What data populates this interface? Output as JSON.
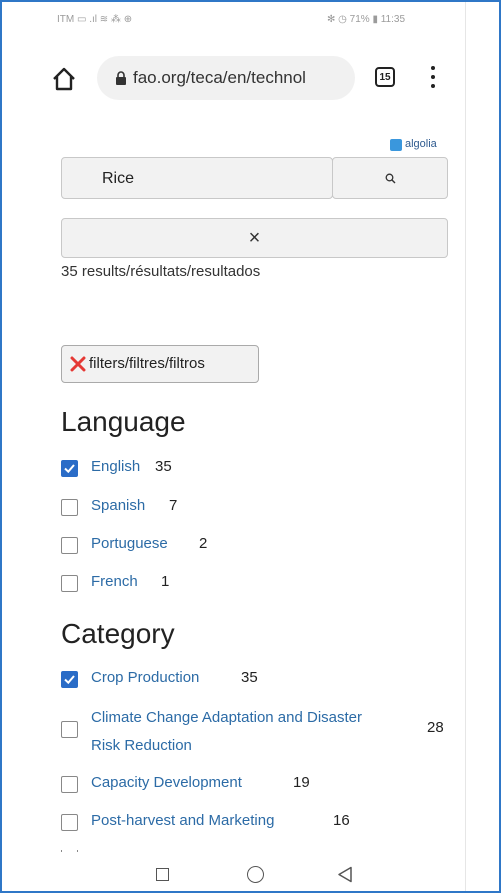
{
  "status_bar": {
    "left": "ITM ▭ .ıl ≋ ⁂ ⊕",
    "right": "✻ ◷ 71% ▮ 11:35"
  },
  "browser": {
    "url": "fao.org/teca/en/technol",
    "tab_count": "15"
  },
  "search": {
    "powered_by": "algolia",
    "query": "Rice",
    "clear_label": "×",
    "results_text": "35 results/résultats/resultados"
  },
  "filters_button": {
    "label": "filters/filtres/filtros"
  },
  "language": {
    "heading": "Language",
    "items": [
      {
        "label": "English",
        "count": "35",
        "checked": true
      },
      {
        "label": "Spanish",
        "count": "7",
        "checked": false
      },
      {
        "label": "Portuguese",
        "count": "2",
        "checked": false
      },
      {
        "label": "French",
        "count": "1",
        "checked": false
      }
    ]
  },
  "category": {
    "heading": "Category",
    "items": [
      {
        "label": "Crop Production",
        "count": "35",
        "checked": true
      },
      {
        "label": "Climate Change Adaptation and Disaster Risk Reduction",
        "count": "28",
        "checked": false
      },
      {
        "label": "Capacity Development",
        "count": "19",
        "checked": false
      },
      {
        "label": "Post-harvest and Marketing",
        "count": "16",
        "checked": false
      }
    ]
  },
  "colors": {
    "link": "#2c6ba6",
    "checkbox_checked": "#2a6cc7",
    "frame_border": "#2f77c7",
    "filters_x": "#e53935"
  },
  "icons": {
    "home": "home-icon",
    "lock": "lock-icon",
    "menu": "more-vert-icon",
    "search": "search-icon",
    "clear": "close-icon",
    "filters_x": "close-x-red-icon",
    "nav_recent": "square-icon",
    "nav_home": "circle-icon",
    "nav_back": "triangle-back-icon"
  }
}
